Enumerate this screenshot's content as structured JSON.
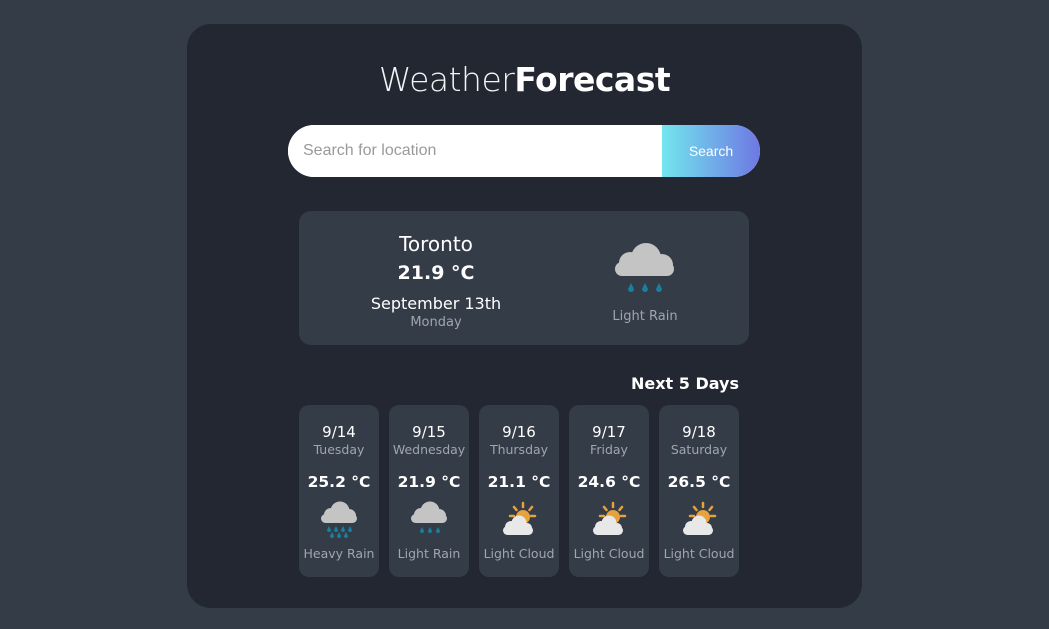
{
  "app": {
    "title_light": "Weather",
    "title_bold": "Forecast"
  },
  "search": {
    "placeholder": "Search for location",
    "value": "",
    "button_label": "Search"
  },
  "today": {
    "city": "Toronto",
    "temperature": "21.9 °C",
    "date": "September 13th",
    "weekday": "Monday",
    "condition": "Light Rain",
    "icon": "light-rain-icon"
  },
  "forecast": {
    "heading": "Next 5 Days",
    "days": [
      {
        "date": "9/14",
        "weekday": "Tuesday",
        "temp": "25.2 °C",
        "condition": "Heavy Rain",
        "icon": "heavy-rain-icon"
      },
      {
        "date": "9/15",
        "weekday": "Wednesday",
        "temp": "21.9 °C",
        "condition": "Light Rain",
        "icon": "light-rain-icon"
      },
      {
        "date": "9/16",
        "weekday": "Thursday",
        "temp": "21.1 °C",
        "condition": "Light Cloud",
        "icon": "light-cloud-icon"
      },
      {
        "date": "9/17",
        "weekday": "Friday",
        "temp": "24.6 °C",
        "condition": "Light Cloud",
        "icon": "light-cloud-icon"
      },
      {
        "date": "9/18",
        "weekday": "Saturday",
        "temp": "26.5 °C",
        "condition": "Light Cloud",
        "icon": "light-cloud-icon"
      }
    ]
  },
  "colors": {
    "background": "#343c48",
    "panel": "#222731",
    "card": "#343c48",
    "accent_start": "#72e6ee",
    "accent_end": "#6e78e3",
    "rain": "#1a7f9c",
    "sun": "#e6a23c"
  }
}
